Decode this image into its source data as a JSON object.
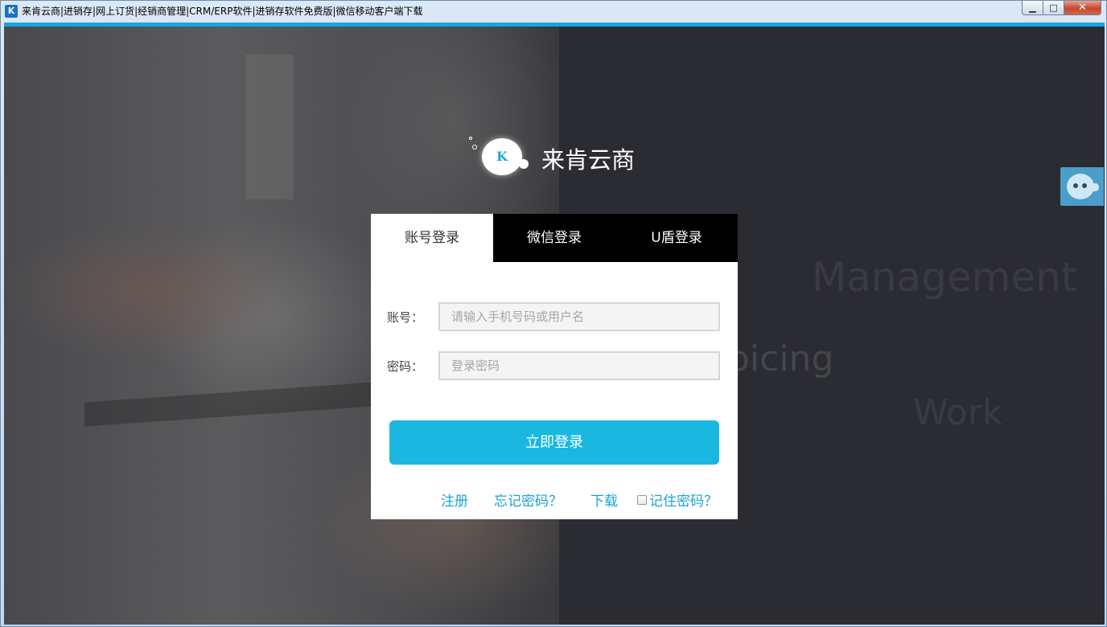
{
  "window": {
    "title": "来肯云商|进销存|网上订货|经销商管理|CRM/ERP软件|进销存软件免费版|微信移动客户端下载",
    "app_icon": "K",
    "minimize_icon": "minimize-icon",
    "maximize_icon": "maximize-icon",
    "close_icon": "close-icon",
    "minimize_glyph": "▁",
    "maximize_glyph": "□",
    "close_glyph": "✕"
  },
  "brand": {
    "name": "来肯云商",
    "logo_letter": "K",
    "accent_color": "#1ab8e0"
  },
  "background_words": {
    "management": "Management",
    "invoicing": "oicing",
    "work": "Work"
  },
  "login": {
    "tabs": [
      {
        "label": "账号登录",
        "active": true
      },
      {
        "label": "微信登录",
        "active": false
      },
      {
        "label": "U盾登录",
        "active": false
      }
    ],
    "account_label": "账号：",
    "account_placeholder": "请输入手机号码或用户名",
    "account_value": "",
    "password_label": "密码：",
    "password_placeholder": "登录密码",
    "password_value": "",
    "submit_label": "立即登录",
    "register_label": "注册",
    "forgot_label": "忘记密码？",
    "download_label": "下载",
    "remember_label": "记住密码？",
    "remember_checked": false
  },
  "side_widget": {
    "icon": "mascot-icon"
  }
}
